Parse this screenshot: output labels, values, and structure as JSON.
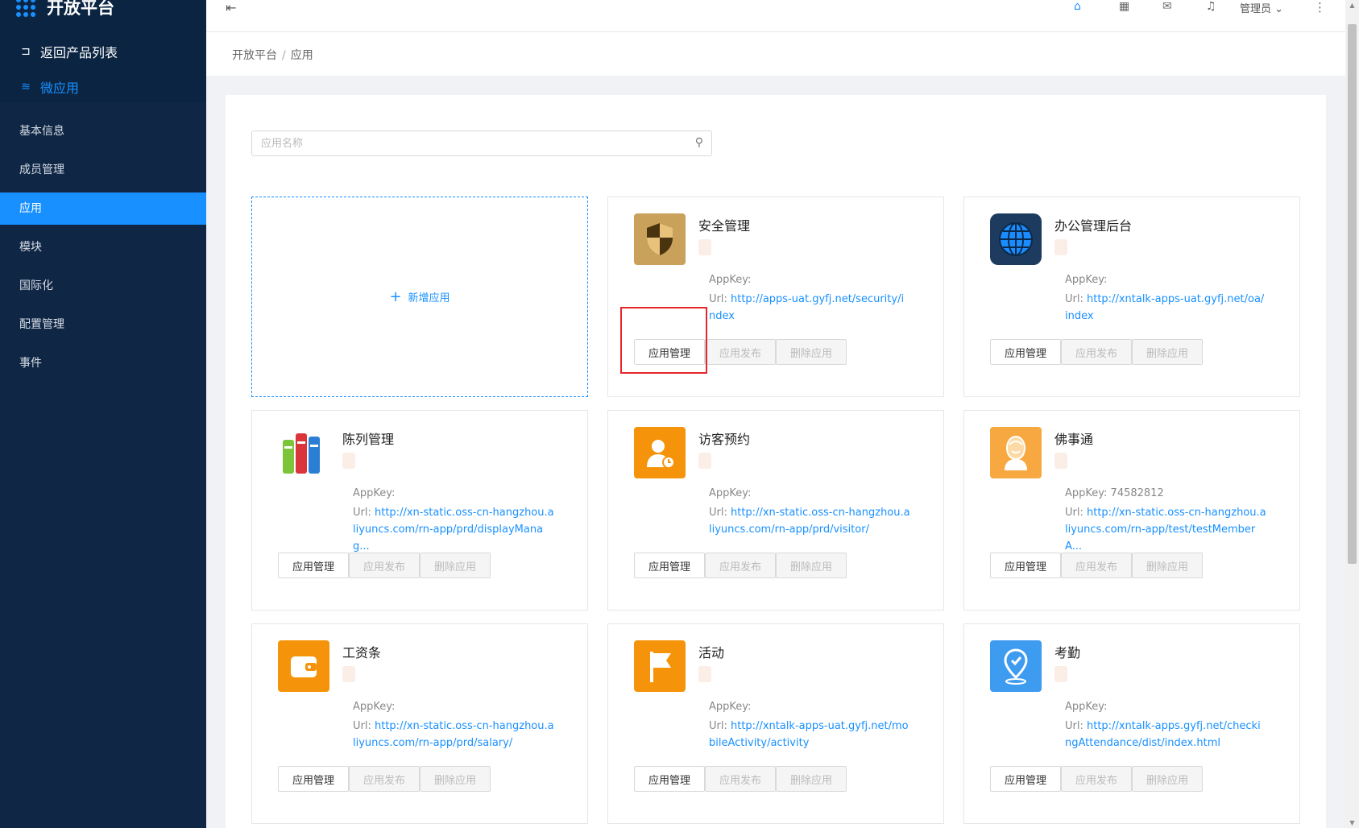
{
  "brand": {
    "title": "开放平台"
  },
  "side_links": {
    "back": "返回产品列表",
    "micro": "微应用"
  },
  "menu": [
    {
      "label": "基本信息",
      "active": false
    },
    {
      "label": "成员管理",
      "active": false
    },
    {
      "label": "应用",
      "active": true
    },
    {
      "label": "模块",
      "active": false
    },
    {
      "label": "国际化",
      "active": false
    },
    {
      "label": "配置管理",
      "active": false
    },
    {
      "label": "事件",
      "active": false
    }
  ],
  "header": {
    "user": "管理员"
  },
  "breadcrumb": {
    "root": "开放平台",
    "sep": "/",
    "current": "应用"
  },
  "search": {
    "placeholder": "应用名称",
    "value": ""
  },
  "add_app": {
    "label": "新增应用"
  },
  "buttons": {
    "manage": "应用管理",
    "publish": "应用发布",
    "delete": "删除应用"
  },
  "apps": [
    {
      "name": "安全管理",
      "appkey_label": "AppKey:",
      "appkey": "",
      "url_label": "Url:",
      "url": "http://apps-uat.gyfj.net/security/index",
      "icon": "shield-icon",
      "color": "#c9a15a"
    },
    {
      "name": "办公管理后台",
      "appkey_label": "AppKey:",
      "appkey": "",
      "url_label": "Url:",
      "url": "http://xntalk-apps-uat.gyfj.net/oa/index",
      "icon": "globe-icon",
      "color": "#1c3b5e"
    },
    {
      "name": "陈列管理",
      "appkey_label": "AppKey:",
      "appkey": "",
      "url_label": "Url:",
      "url": "http://xn-static.oss-cn-hangzhou.aliyuncs.com/rn-app/prd/displayManag...",
      "icon": "books-icon",
      "color": "#ffffff"
    },
    {
      "name": "访客预约",
      "appkey_label": "AppKey:",
      "appkey": "",
      "url_label": "Url:",
      "url": "http://xn-static.oss-cn-hangzhou.aliyuncs.com/rn-app/prd/visitor/",
      "icon": "visitor-icon",
      "color": "#f5940a"
    },
    {
      "name": "佛事通",
      "appkey_label": "AppKey:",
      "appkey": "74582812",
      "url_label": "Url:",
      "url": "http://xn-static.oss-cn-hangzhou.aliyuncs.com/rn-app/test/testMemberA...",
      "icon": "buddha-icon",
      "color": "#f8a840"
    },
    {
      "name": "工资条",
      "appkey_label": "AppKey:",
      "appkey": "",
      "url_label": "Url:",
      "url": "http://xn-static.oss-cn-hangzhou.aliyuncs.com/rn-app/prd/salary/",
      "icon": "wallet-icon",
      "color": "#f5940a"
    },
    {
      "name": "活动",
      "appkey_label": "AppKey:",
      "appkey": "",
      "url_label": "Url:",
      "url": "http://xntalk-apps-uat.gyfj.net/mobileActivity/activity",
      "icon": "flag-icon",
      "color": "#f5940a"
    },
    {
      "name": "考勤",
      "appkey_label": "AppKey:",
      "appkey": "",
      "url_label": "Url:",
      "url": "http://xntalk-apps.gyfj.net/checkingAttendance/dist/index.html",
      "icon": "location-icon",
      "color": "#3d9bf0"
    }
  ]
}
